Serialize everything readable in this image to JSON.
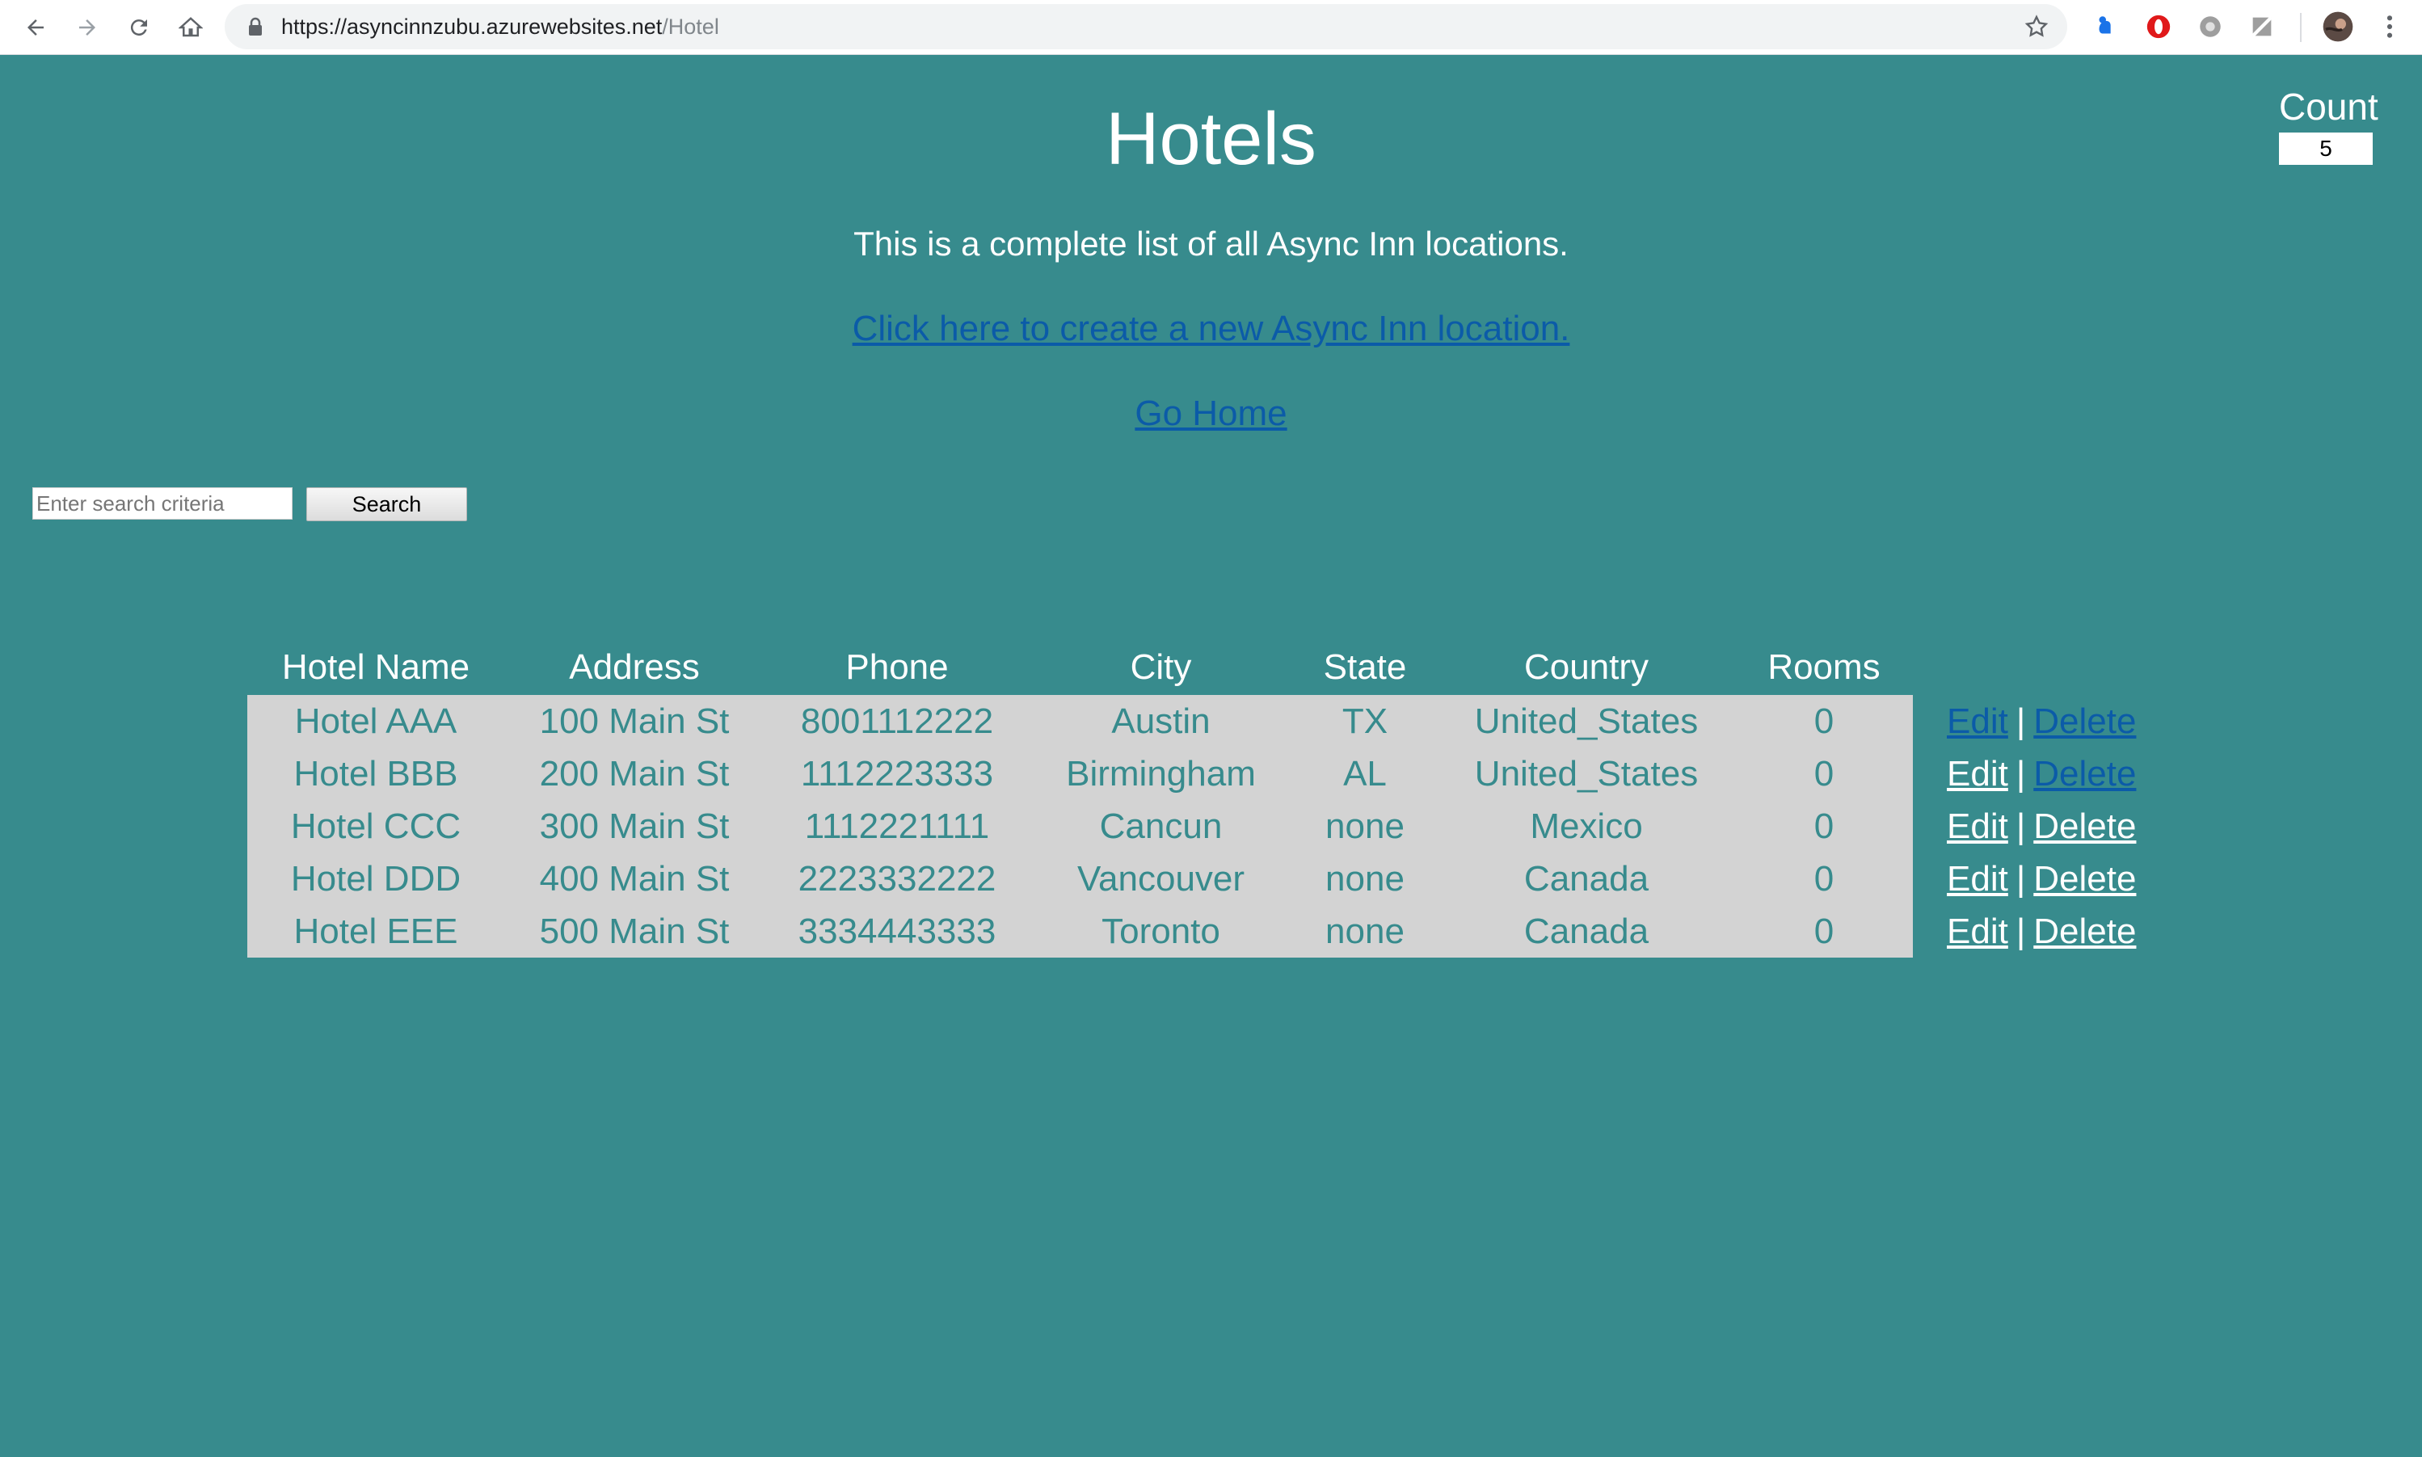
{
  "browser": {
    "url_host": "https://asyncinnzubu.azurewebsites.net",
    "url_path": "/Hotel"
  },
  "page": {
    "title": "Hotels",
    "intro": "This is a complete list of all Async Inn locations.",
    "create_link": "Click here to create a new Async Inn location.",
    "home_link": "Go Home"
  },
  "count": {
    "label": "Count",
    "value": "5"
  },
  "search": {
    "placeholder": "Enter search criteria",
    "button_label": "Search"
  },
  "table": {
    "headers": [
      "Hotel Name",
      "Address",
      "Phone",
      "City",
      "State",
      "Country",
      "Rooms"
    ],
    "rows": [
      {
        "name": "Hotel AAA",
        "address": "100 Main St",
        "phone": "8001112222",
        "city": "Austin",
        "state": "TX",
        "country": "United_States",
        "rooms": "0"
      },
      {
        "name": "Hotel BBB",
        "address": "200 Main St",
        "phone": "1112223333",
        "city": "Birmingham",
        "state": "AL",
        "country": "United_States",
        "rooms": "0"
      },
      {
        "name": "Hotel CCC",
        "address": "300 Main St",
        "phone": "1112221111",
        "city": "Cancun",
        "state": "none",
        "country": "Mexico",
        "rooms": "0"
      },
      {
        "name": "Hotel DDD",
        "address": "400 Main St",
        "phone": "2223332222",
        "city": "Vancouver",
        "state": "none",
        "country": "Canada",
        "rooms": "0"
      },
      {
        "name": "Hotel EEE",
        "address": "500 Main St",
        "phone": "3334443333",
        "city": "Toronto",
        "state": "none",
        "country": "Canada",
        "rooms": "0"
      }
    ],
    "edit_label": "Edit",
    "separator": "|",
    "delete_label": "Delete"
  },
  "colors": {
    "page_background": "#378b8d",
    "table_background": "#d3d3d3",
    "link_blue": "#0b5ba8"
  },
  "icons": [
    "back-icon",
    "forward-icon",
    "reload-icon",
    "home-icon",
    "lock-icon",
    "bookmark-star-icon",
    "extension-icon",
    "opera-icon",
    "settings-extension-icon",
    "extension-slash-icon",
    "profile-avatar",
    "menu-dots-icon"
  ]
}
